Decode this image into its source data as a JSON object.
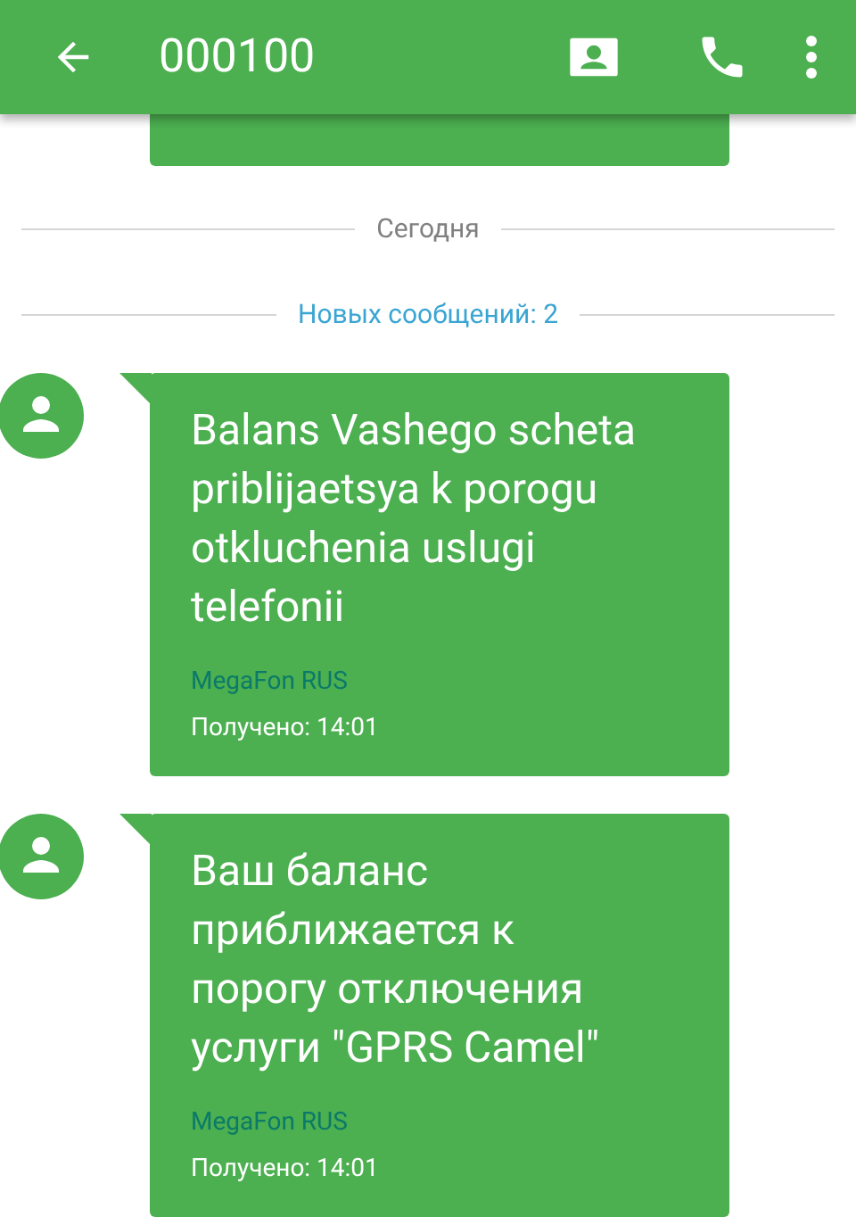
{
  "toolbar": {
    "title": "000100"
  },
  "dividers": [
    {
      "kind": "date",
      "label": "Сегодня"
    },
    {
      "kind": "new",
      "label": "Новых сообщений: 2"
    }
  ],
  "messages": [
    {
      "text": "Balans Vashego scheta priblijaetsya k porogu otkluchenia uslugi telefonii",
      "sender": "MegaFon RUS",
      "received": "Получено: 14:01"
    },
    {
      "text": "Ваш баланс приближается к порогу отключения услуги \"GPRS Camel\"",
      "sender": "MegaFon RUS",
      "received": "Получено: 14:01"
    }
  ]
}
